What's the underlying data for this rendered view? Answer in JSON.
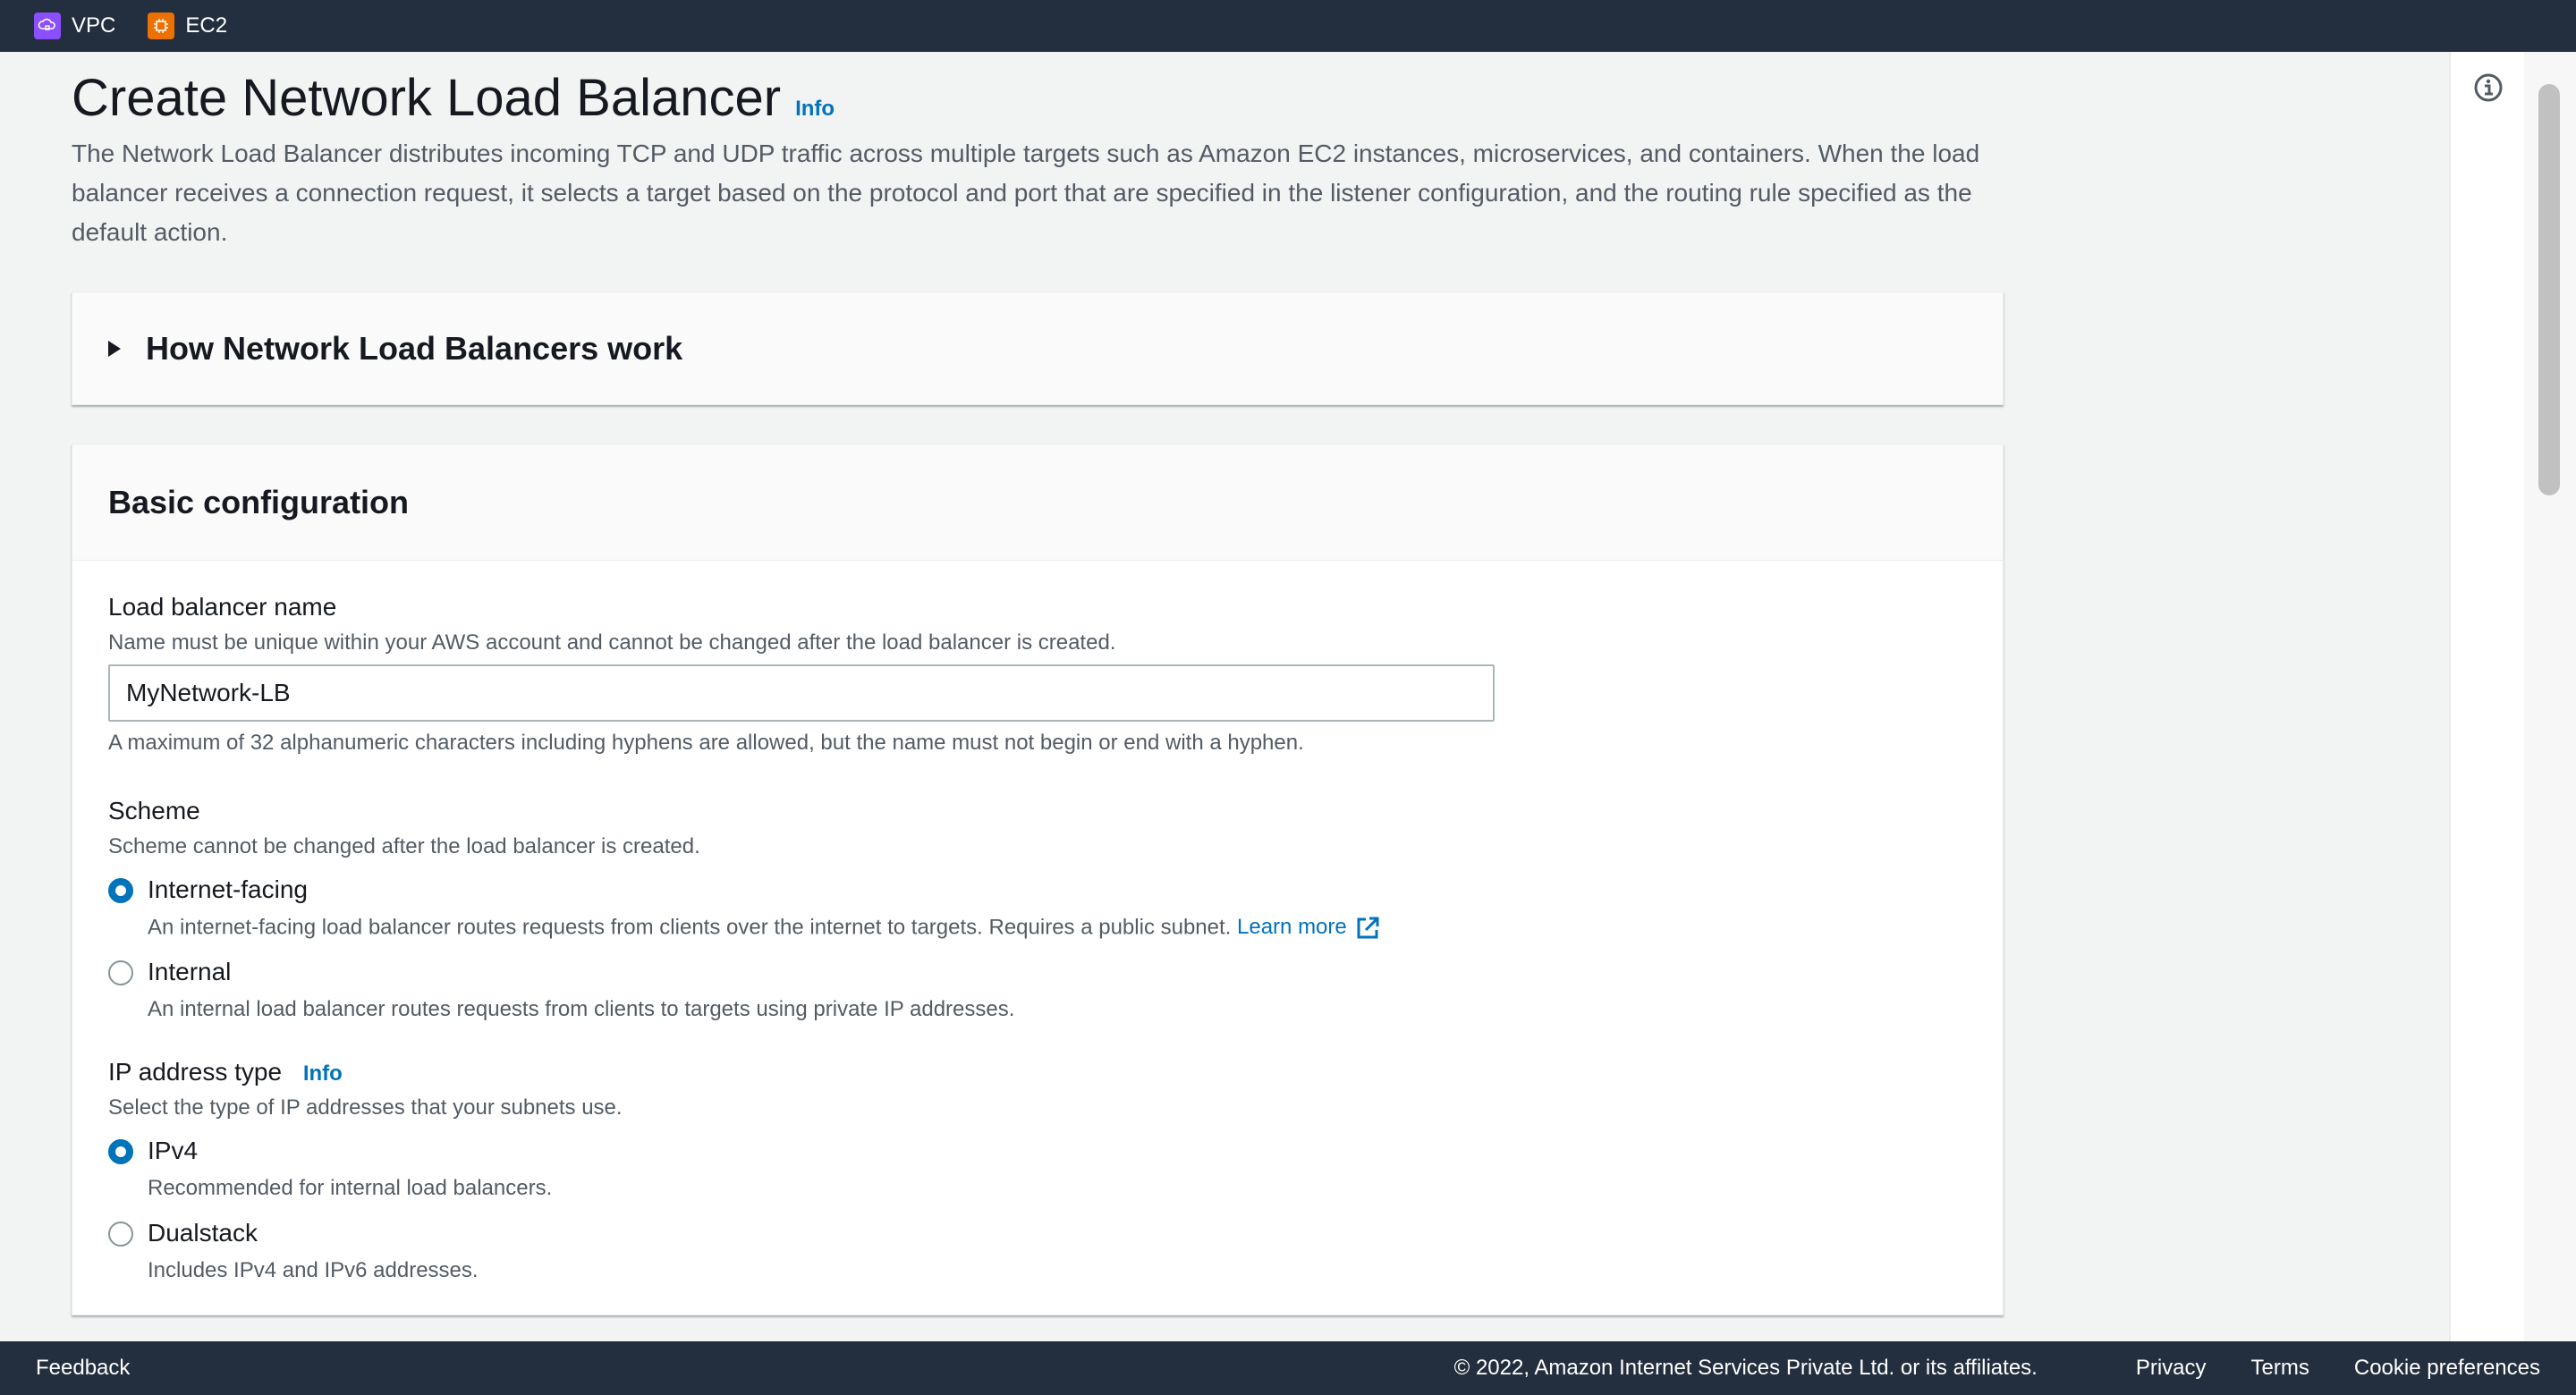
{
  "topbar": {
    "favorites": [
      {
        "label": "VPC",
        "icon": "vpc-icon",
        "color": "#8c4fff"
      },
      {
        "label": "EC2",
        "icon": "ec2-icon",
        "color": "#ed7100"
      }
    ]
  },
  "page": {
    "title": "Create Network Load Balancer",
    "info": "Info",
    "description": "The Network Load Balancer distributes incoming TCP and UDP traffic across multiple targets such as Amazon EC2 instances, microservices, and containers. When the load balancer receives a connection request, it selects a target based on the protocol and port that are specified in the listener configuration, and the routing rule specified as the default action."
  },
  "how_it_works": {
    "title": "How Network Load Balancers work",
    "expanded": false
  },
  "basic_config": {
    "title": "Basic configuration",
    "lb_name": {
      "label": "Load balancer name",
      "description": "Name must be unique within your AWS account and cannot be changed after the load balancer is created.",
      "value": "MyNetwork-LB",
      "constraint": "A maximum of 32 alphanumeric characters including hyphens are allowed, but the name must not begin or end with a hyphen."
    },
    "scheme": {
      "label": "Scheme",
      "description": "Scheme cannot be changed after the load balancer is created.",
      "options": [
        {
          "label": "Internet-facing",
          "description": "An internet-facing load balancer routes requests from clients over the internet to targets. Requires a public subnet.",
          "link": "Learn more",
          "checked": true
        },
        {
          "label": "Internal",
          "description": "An internal load balancer routes requests from clients to targets using private IP addresses.",
          "checked": false
        }
      ]
    },
    "ip_type": {
      "label": "IP address type",
      "info": "Info",
      "description": "Select the type of IP addresses that your subnets use.",
      "options": [
        {
          "label": "IPv4",
          "description": "Recommended for internal load balancers.",
          "checked": true
        },
        {
          "label": "Dualstack",
          "description": "Includes IPv4 and IPv6 addresses.",
          "checked": false
        }
      ]
    }
  },
  "footer": {
    "feedback": "Feedback",
    "copyright": "© 2022, Amazon Internet Services Private Ltd. or its affiliates.",
    "links": [
      "Privacy",
      "Terms",
      "Cookie preferences"
    ]
  },
  "colors": {
    "accent": "#0073bb",
    "nav_bg": "#232f3e"
  }
}
